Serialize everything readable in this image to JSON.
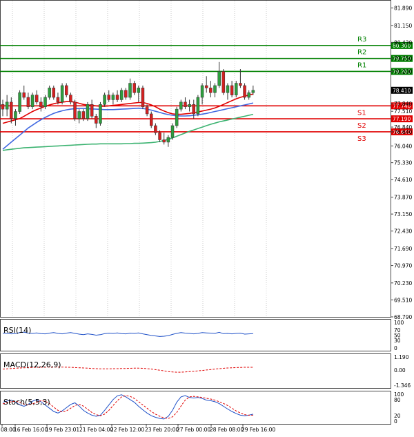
{
  "chart_data": {
    "type": "candlestick",
    "y_ticks": [
      "81.890",
      "81.150",
      "80.430",
      "79.750",
      "79.200",
      "78.410",
      "77.840",
      "77.510",
      "76.840",
      "76.640",
      "76.040",
      "75.330",
      "74.610",
      "73.870",
      "73.150",
      "72.430",
      "71.690",
      "70.970",
      "70.230",
      "69.510",
      "68.790"
    ],
    "x_ticks": [
      "08:00",
      "16 Feb 16:00",
      "19 Feb 23:01",
      "21 Feb 04:00",
      "22 Feb 12:00",
      "23 Feb 20:00",
      "27 Feb 00:00",
      "28 Feb 08:00",
      "29 Feb 16:00"
    ],
    "current_price": "78.410",
    "ylim": [
      68.79,
      82.2
    ],
    "levels": [
      {
        "name": "R3",
        "value": 80.3,
        "tag": "80.300",
        "color": "#008000"
      },
      {
        "name": "R2",
        "value": 79.75,
        "tag": "79.750",
        "color": "#008000"
      },
      {
        "name": "R1",
        "value": 79.2,
        "tag": "79.200",
        "color": "#008000"
      },
      {
        "name": "S1",
        "value": 77.74,
        "tag": "77.740",
        "color": "#e00000"
      },
      {
        "name": "S2",
        "value": 77.19,
        "tag": "77.190",
        "color": "#e00000"
      },
      {
        "name": "S3",
        "value": 76.64,
        "tag": "76.640",
        "color": "#e00000"
      }
    ],
    "candles": [
      [
        77.8,
        78.0,
        77.3,
        77.6
      ],
      [
        77.6,
        78.2,
        77.3,
        77.9
      ],
      [
        77.9,
        78.1,
        77.0,
        77.2
      ],
      [
        77.2,
        77.6,
        76.9,
        77.5
      ],
      [
        77.5,
        78.4,
        77.4,
        78.3
      ],
      [
        78.3,
        78.6,
        78.0,
        78.1
      ],
      [
        78.1,
        78.3,
        77.6,
        77.7
      ],
      [
        77.7,
        78.3,
        77.6,
        78.2
      ],
      [
        78.2,
        78.4,
        77.8,
        77.9
      ],
      [
        77.9,
        78.1,
        77.5,
        77.7
      ],
      [
        77.7,
        78.2,
        77.6,
        78.1
      ],
      [
        78.1,
        78.6,
        78.0,
        78.5
      ],
      [
        78.5,
        78.6,
        78.0,
        78.1
      ],
      [
        78.1,
        78.3,
        77.8,
        77.9
      ],
      [
        77.9,
        78.7,
        77.8,
        78.6
      ],
      [
        78.6,
        78.7,
        78.1,
        78.2
      ],
      [
        78.2,
        78.3,
        77.8,
        77.9
      ],
      [
        77.9,
        78.0,
        77.1,
        77.2
      ],
      [
        77.2,
        77.6,
        77.0,
        77.5
      ],
      [
        77.5,
        77.6,
        77.1,
        77.2
      ],
      [
        77.2,
        77.9,
        77.1,
        77.8
      ],
      [
        77.8,
        78.0,
        77.2,
        77.3
      ],
      [
        77.3,
        77.4,
        76.8,
        77.0
      ],
      [
        77.0,
        77.9,
        76.9,
        77.8
      ],
      [
        77.8,
        78.3,
        77.7,
        78.2
      ],
      [
        78.2,
        78.4,
        77.9,
        78.0
      ],
      [
        78.0,
        78.3,
        77.8,
        78.2
      ],
      [
        78.2,
        78.4,
        77.9,
        78.0
      ],
      [
        78.0,
        78.5,
        77.9,
        78.4
      ],
      [
        78.4,
        78.5,
        78.0,
        78.1
      ],
      [
        78.1,
        78.9,
        78.0,
        78.7
      ],
      [
        78.7,
        78.8,
        78.2,
        78.3
      ],
      [
        78.3,
        78.6,
        77.9,
        78.5
      ],
      [
        78.5,
        78.6,
        77.6,
        77.7
      ],
      [
        77.7,
        77.8,
        77.3,
        77.4
      ],
      [
        77.4,
        77.5,
        76.8,
        76.9
      ],
      [
        76.9,
        77.0,
        76.5,
        76.6
      ],
      [
        76.6,
        76.7,
        76.2,
        76.3
      ],
      [
        76.3,
        76.6,
        76.1,
        76.2
      ],
      [
        76.2,
        76.5,
        76.0,
        76.4
      ],
      [
        76.4,
        77.0,
        76.3,
        76.9
      ],
      [
        76.9,
        77.7,
        76.8,
        77.6
      ],
      [
        77.6,
        78.0,
        77.5,
        77.9
      ],
      [
        77.9,
        78.1,
        77.6,
        77.7
      ],
      [
        77.7,
        78.0,
        77.5,
        77.8
      ],
      [
        77.8,
        78.0,
        77.2,
        77.4
      ],
      [
        77.4,
        78.2,
        77.3,
        78.1
      ],
      [
        78.1,
        78.7,
        77.8,
        78.6
      ],
      [
        78.6,
        79.0,
        78.3,
        78.5
      ],
      [
        78.5,
        78.8,
        78.1,
        78.3
      ],
      [
        78.3,
        78.7,
        78.1,
        78.6
      ],
      [
        78.6,
        79.6,
        78.5,
        79.2
      ],
      [
        79.2,
        79.3,
        78.2,
        78.3
      ],
      [
        78.3,
        78.7,
        78.0,
        78.6
      ],
      [
        78.6,
        78.8,
        78.1,
        78.2
      ],
      [
        78.2,
        78.8,
        78.1,
        78.7
      ],
      [
        78.7,
        79.3,
        78.5,
        78.6
      ],
      [
        78.6,
        78.7,
        78.0,
        78.1
      ],
      [
        78.1,
        78.4,
        78.0,
        78.3
      ],
      [
        78.3,
        78.6,
        78.2,
        78.4
      ]
    ],
    "ma_red": [
      77.0,
      77.05,
      77.1,
      77.15,
      77.2,
      77.3,
      77.4,
      77.5,
      77.58,
      77.65,
      77.72,
      77.78,
      77.83,
      77.87,
      77.9,
      77.92,
      77.92,
      77.9,
      77.85,
      77.8,
      77.78,
      77.76,
      77.74,
      77.72,
      77.72,
      77.74,
      77.76,
      77.78,
      77.8,
      77.82,
      77.84,
      77.86,
      77.88,
      77.88,
      77.84,
      77.78,
      77.7,
      77.6,
      77.52,
      77.45,
      77.4,
      77.38,
      77.38,
      77.4,
      77.42,
      77.45,
      77.48,
      77.52,
      77.56,
      77.6,
      77.65,
      77.72,
      77.8,
      77.88,
      77.96,
      78.04,
      78.1,
      78.15,
      78.2,
      78.24
    ],
    "ma_blue": [
      75.9,
      76.05,
      76.2,
      76.35,
      76.5,
      76.65,
      76.8,
      76.92,
      77.04,
      77.15,
      77.25,
      77.34,
      77.42,
      77.48,
      77.53,
      77.57,
      77.6,
      77.62,
      77.63,
      77.63,
      77.62,
      77.61,
      77.6,
      77.59,
      77.58,
      77.58,
      77.58,
      77.59,
      77.6,
      77.61,
      77.62,
      77.63,
      77.64,
      77.63,
      77.6,
      77.56,
      77.51,
      77.46,
      77.41,
      77.37,
      77.34,
      77.32,
      77.31,
      77.31,
      77.32,
      77.34,
      77.36,
      77.39,
      77.42,
      77.46,
      77.5,
      77.54,
      77.58,
      77.62,
      77.66,
      77.7,
      77.74,
      77.78,
      77.82,
      77.86
    ],
    "ma_green": [
      75.85,
      75.88,
      75.9,
      75.92,
      75.94,
      75.96,
      75.97,
      75.98,
      75.99,
      76.0,
      76.01,
      76.02,
      76.03,
      76.04,
      76.05,
      76.06,
      76.07,
      76.08,
      76.09,
      76.1,
      76.11,
      76.12,
      76.12,
      76.13,
      76.13,
      76.13,
      76.13,
      76.13,
      76.13,
      76.14,
      76.14,
      76.15,
      76.15,
      76.16,
      76.17,
      76.18,
      76.2,
      76.23,
      76.27,
      76.32,
      76.38,
      76.45,
      76.52,
      76.59,
      76.66,
      76.72,
      76.78,
      76.84,
      76.9,
      76.96,
      77.01,
      77.06,
      77.1,
      77.14,
      77.18,
      77.22,
      77.26,
      77.3,
      77.34,
      77.38
    ],
    "indicators": [
      {
        "name": "RSI(14)",
        "ticks": [
          "100",
          "70",
          "50",
          "30",
          "0"
        ],
        "ylim": [
          0,
          100
        ],
        "tick_values": [
          100,
          70,
          50,
          30,
          0
        ],
        "series": [
          {
            "color": "#1e50c8",
            "dash": false,
            "values": [
              58,
              57,
              55,
              56,
              60,
              62,
              58,
              57,
              59,
              56,
              55,
              58,
              60,
              57,
              55,
              58,
              60,
              57,
              54,
              52,
              55,
              53,
              50,
              52,
              56,
              58,
              57,
              59,
              56,
              55,
              58,
              57,
              59,
              55,
              52,
              49,
              47,
              45,
              46,
              48,
              53,
              57,
              60,
              58,
              57,
              55,
              57,
              60,
              59,
              58,
              57,
              61,
              56,
              57,
              55,
              57,
              58,
              54,
              55,
              56
            ]
          }
        ]
      },
      {
        "name": "MACD(12,26,9)",
        "ticks": [
          "1.190",
          "0.00",
          "-1.346"
        ],
        "ylim": [
          -1.346,
          1.19
        ],
        "tick_values": [
          1.19,
          0,
          -1.346
        ],
        "series": [
          {
            "color": "#e00000",
            "dash": true,
            "values": [
              0.1,
              0.12,
              0.15,
              0.18,
              0.2,
              0.22,
              0.24,
              0.25,
              0.26,
              0.27,
              0.27,
              0.28,
              0.28,
              0.28,
              0.28,
              0.27,
              0.26,
              0.24,
              0.22,
              0.2,
              0.18,
              0.16,
              0.14,
              0.12,
              0.12,
              0.12,
              0.13,
              0.14,
              0.15,
              0.16,
              0.17,
              0.18,
              0.18,
              0.17,
              0.14,
              0.1,
              0.05,
              0.0,
              -0.06,
              -0.12,
              -0.16,
              -0.18,
              -0.18,
              -0.16,
              -0.13,
              -0.1,
              -0.06,
              -0.02,
              0.02,
              0.06,
              0.1,
              0.14,
              0.17,
              0.2,
              0.22,
              0.24,
              0.25,
              0.26,
              0.26,
              0.26
            ]
          }
        ]
      },
      {
        "name": "Stoch(5,5,3)",
        "ticks": [
          "100",
          "80",
          "20",
          "0"
        ],
        "ylim": [
          0,
          100
        ],
        "tick_values": [
          100,
          80,
          20,
          0
        ],
        "series": [
          {
            "color": "#1e50c8",
            "dash": false,
            "values": [
              70,
              75,
              78,
              70,
              60,
              55,
              62,
              74,
              80,
              72,
              60,
              48,
              36,
              30,
              38,
              50,
              62,
              68,
              56,
              40,
              30,
              22,
              18,
              22,
              40,
              60,
              80,
              94,
              98,
              90,
              80,
              70,
              55,
              42,
              30,
              20,
              14,
              10,
              8,
              18,
              40,
              70,
              90,
              95,
              88,
              86,
              88,
              84,
              78,
              76,
              72,
              65,
              55,
              45,
              36,
              28,
              22,
              20,
              22,
              26
            ]
          },
          {
            "color": "#e00000",
            "dash": true,
            "values": [
              64,
              68,
              72,
              74,
              70,
              63,
              60,
              64,
              70,
              76,
              74,
              65,
              52,
              40,
              34,
              38,
              48,
              58,
              62,
              56,
              44,
              32,
              24,
              20,
              26,
              40,
              58,
              76,
              90,
              95,
              92,
              84,
              72,
              60,
              48,
              36,
              26,
              18,
              12,
              10,
              16,
              32,
              56,
              78,
              90,
              92,
              90,
              88,
              85,
              82,
              78,
              72,
              66,
              58,
              48,
              38,
              30,
              24,
              22,
              22
            ]
          }
        ]
      }
    ]
  }
}
